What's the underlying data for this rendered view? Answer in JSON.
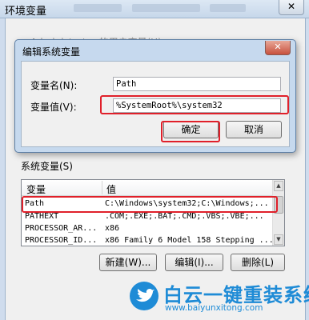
{
  "outer_window": {
    "title": "环境变量",
    "close_symbol": "✕",
    "user_vars_label": "Administrator 的用户变量(U)"
  },
  "edit_dialog": {
    "title": "编辑系统变量",
    "close_symbol": "✕",
    "name_label": "变量名(N):",
    "name_value": "Path",
    "value_label": "变量值(V):",
    "value_value": "%SystemRoot%\\system32",
    "ok_button": "确定",
    "cancel_button": "取消"
  },
  "system_vars": {
    "group_label": "系统变量(S)",
    "columns": [
      "变量",
      "值"
    ],
    "rows": [
      {
        "name": "Path",
        "value": "C:\\Windows\\system32;C:\\Windows;..."
      },
      {
        "name": "PATHEXT",
        "value": ".COM;.EXE;.BAT;.CMD;.VBS;.VBE;..."
      },
      {
        "name": "PROCESSOR_AR...",
        "value": "x86"
      },
      {
        "name": "PROCESSOR_ID...",
        "value": "x86 Family 6 Model 158 Stepping ..."
      }
    ],
    "new_button": "新建(W)...",
    "edit_button": "编辑(I)...",
    "delete_button": "删除(L)"
  },
  "watermark": {
    "title": "白云一键重装系统",
    "url": "www.baiyunxitong.com"
  },
  "colors": {
    "highlight_border": "#e0202a",
    "watermark_blue": "#1e8bd6",
    "titlebar": "#c6d9ee"
  }
}
